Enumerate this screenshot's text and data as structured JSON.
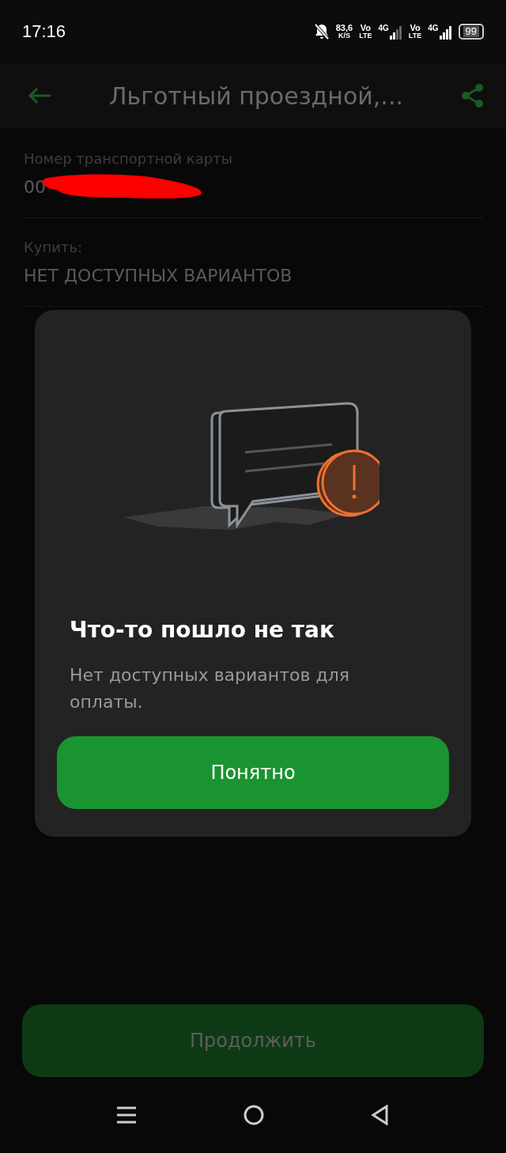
{
  "status_bar": {
    "time": "17:16",
    "speed": "83,6",
    "speed_unit": "K/S",
    "sim1_volte": [
      "Vo",
      "LTE"
    ],
    "sim1_network": "4G",
    "sim2_volte": [
      "Vo",
      "LTE"
    ],
    "sim2_network": "4G",
    "battery": "99"
  },
  "header": {
    "title": "Льготный проездной,..."
  },
  "fields": [
    {
      "label": "Номер транспортной карты",
      "value": "00",
      "redacted": true
    },
    {
      "label": "Купить:",
      "value": "НЕТ ДОСТУПНЫХ ВАРИАНТОВ",
      "redacted": false
    }
  ],
  "dialog": {
    "title": "Что-то пошло не так",
    "message": "Нет доступных вариантов для оплаты.",
    "button": "Понятно"
  },
  "continue_button": {
    "label": "Продолжить",
    "disabled": true
  }
}
